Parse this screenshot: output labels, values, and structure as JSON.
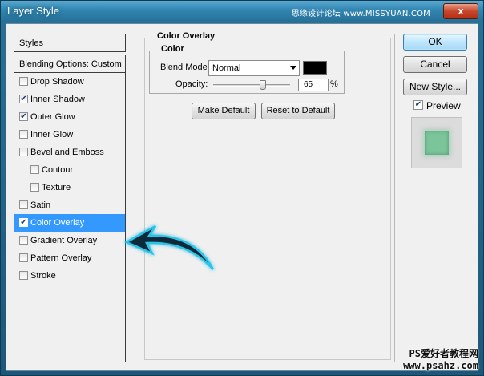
{
  "window": {
    "title": "Layer Style",
    "watermark_top": "思缘设计论坛 www.MISSYUAN.COM",
    "close_glyph": "x"
  },
  "styles_panel": {
    "header": "Styles",
    "blending_options": "Blending Options: Custom",
    "items": [
      {
        "label": "Drop Shadow",
        "checked": false,
        "indent": false,
        "selected": false
      },
      {
        "label": "Inner Shadow",
        "checked": true,
        "indent": false,
        "selected": false
      },
      {
        "label": "Outer Glow",
        "checked": true,
        "indent": false,
        "selected": false
      },
      {
        "label": "Inner Glow",
        "checked": false,
        "indent": false,
        "selected": false
      },
      {
        "label": "Bevel and Emboss",
        "checked": false,
        "indent": false,
        "selected": false
      },
      {
        "label": "Contour",
        "checked": false,
        "indent": true,
        "selected": false
      },
      {
        "label": "Texture",
        "checked": false,
        "indent": true,
        "selected": false
      },
      {
        "label": "Satin",
        "checked": false,
        "indent": false,
        "selected": false
      },
      {
        "label": "Color Overlay",
        "checked": true,
        "indent": false,
        "selected": true
      },
      {
        "label": "Gradient Overlay",
        "checked": false,
        "indent": false,
        "selected": false
      },
      {
        "label": "Pattern Overlay",
        "checked": false,
        "indent": false,
        "selected": false
      },
      {
        "label": "Stroke",
        "checked": false,
        "indent": false,
        "selected": false
      }
    ]
  },
  "color_overlay": {
    "group_title": "Color Overlay",
    "sub_title": "Color",
    "blend_mode_label": "Blend Mode:",
    "blend_mode_value": "Normal",
    "overlay_color": "#000000",
    "opacity_label": "Opacity:",
    "opacity_value": "65",
    "opacity_unit": "%",
    "opacity_fraction": 0.65,
    "make_default_label": "Make Default",
    "reset_default_label": "Reset to Default"
  },
  "actions": {
    "ok_label": "OK",
    "cancel_label": "Cancel",
    "new_style_label": "New Style...",
    "preview_label": "Preview",
    "preview_checked": true,
    "preview_color": "#7cc49a"
  },
  "watermark_bottom": {
    "line1": "PS爱好者教程网",
    "line2": "www.psahz.com"
  },
  "annotation_arrow_color": "#29c4e8"
}
